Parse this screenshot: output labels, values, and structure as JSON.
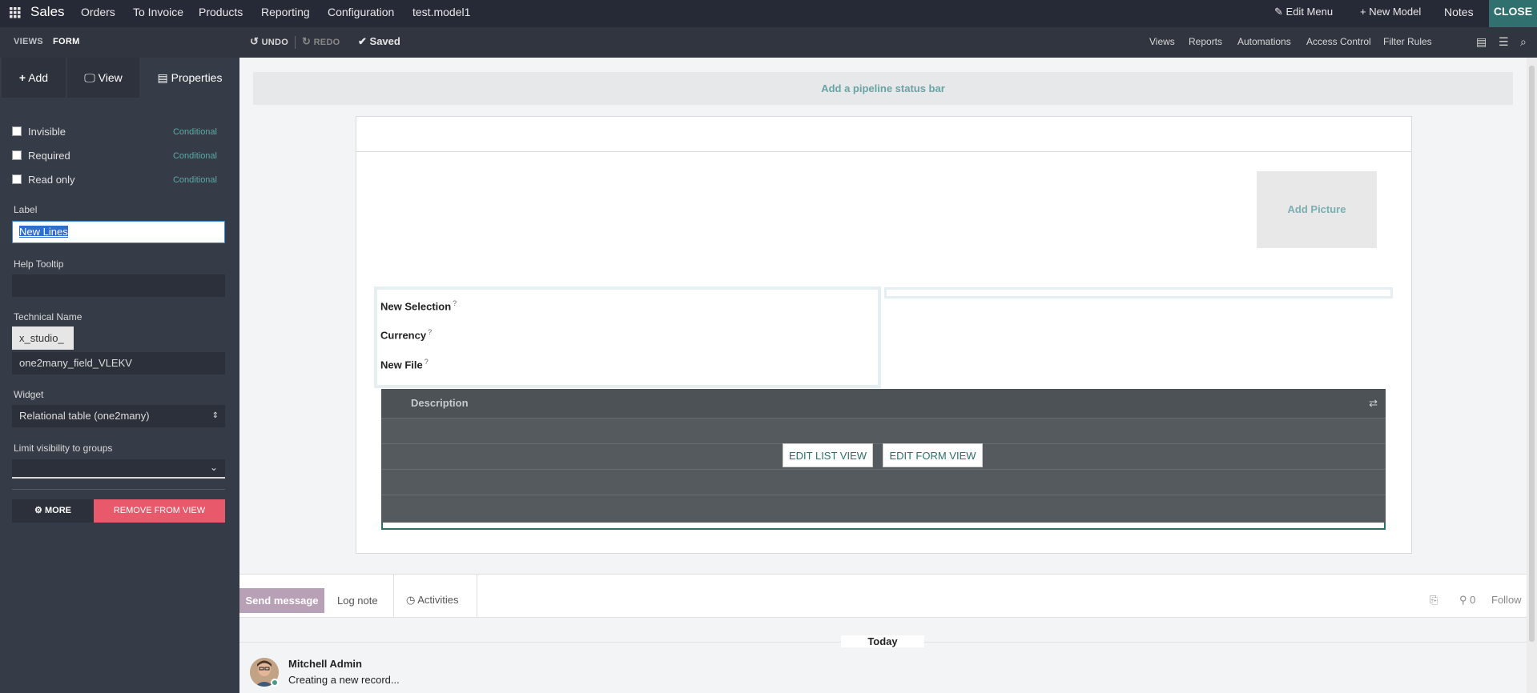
{
  "topnav": {
    "brand": "Sales",
    "menu": [
      "Orders",
      "To Invoice",
      "Products",
      "Reporting",
      "Configuration",
      "test.model1"
    ],
    "edit_menu": "Edit Menu",
    "new_model": "New Model",
    "notes": "Notes",
    "close": "CLOSE"
  },
  "subbar": {
    "views": "VIEWS",
    "form": "FORM",
    "undo": "UNDO",
    "redo": "REDO",
    "saved": "Saved",
    "links": [
      "Views",
      "Reports",
      "Automations",
      "Access Control",
      "Filter Rules"
    ]
  },
  "sidebar": {
    "tabs": [
      "Add",
      "View",
      "Properties"
    ],
    "checks": [
      {
        "label": "Invisible",
        "cond": "Conditional"
      },
      {
        "label": "Required",
        "cond": "Conditional"
      },
      {
        "label": "Read only",
        "cond": "Conditional"
      }
    ],
    "label_title": "Label",
    "label_value": "New Lines",
    "help_title": "Help Tooltip",
    "help_value": "",
    "tech_title": "Technical Name",
    "tech_prefix": "x_studio_",
    "tech_value": "one2many_field_VLEKV",
    "widget_title": "Widget",
    "widget_value": "Relational table (one2many)",
    "groups_title": "Limit visibility to groups",
    "more": "MORE",
    "remove": "REMOVE FROM VIEW"
  },
  "canvas": {
    "pipeline": "Add a pipeline status bar",
    "add_picture": "Add Picture",
    "fields": [
      "New Selection",
      "Currency",
      "New File"
    ],
    "tooltip_mark": "?",
    "o2m_column": "Description",
    "edit_list": "EDIT LIST VIEW",
    "edit_form": "EDIT FORM VIEW"
  },
  "chatter": {
    "send": "Send message",
    "log": "Log note",
    "activities": "Activities",
    "followers_count": "0",
    "follow": "Follow",
    "today": "Today",
    "author": "Mitchell Admin",
    "message": "Creating a new record..."
  },
  "colors": {
    "topbar": "#262a36",
    "sidebar": "#363c47",
    "accent": "#30706e",
    "danger": "#e8596b"
  }
}
